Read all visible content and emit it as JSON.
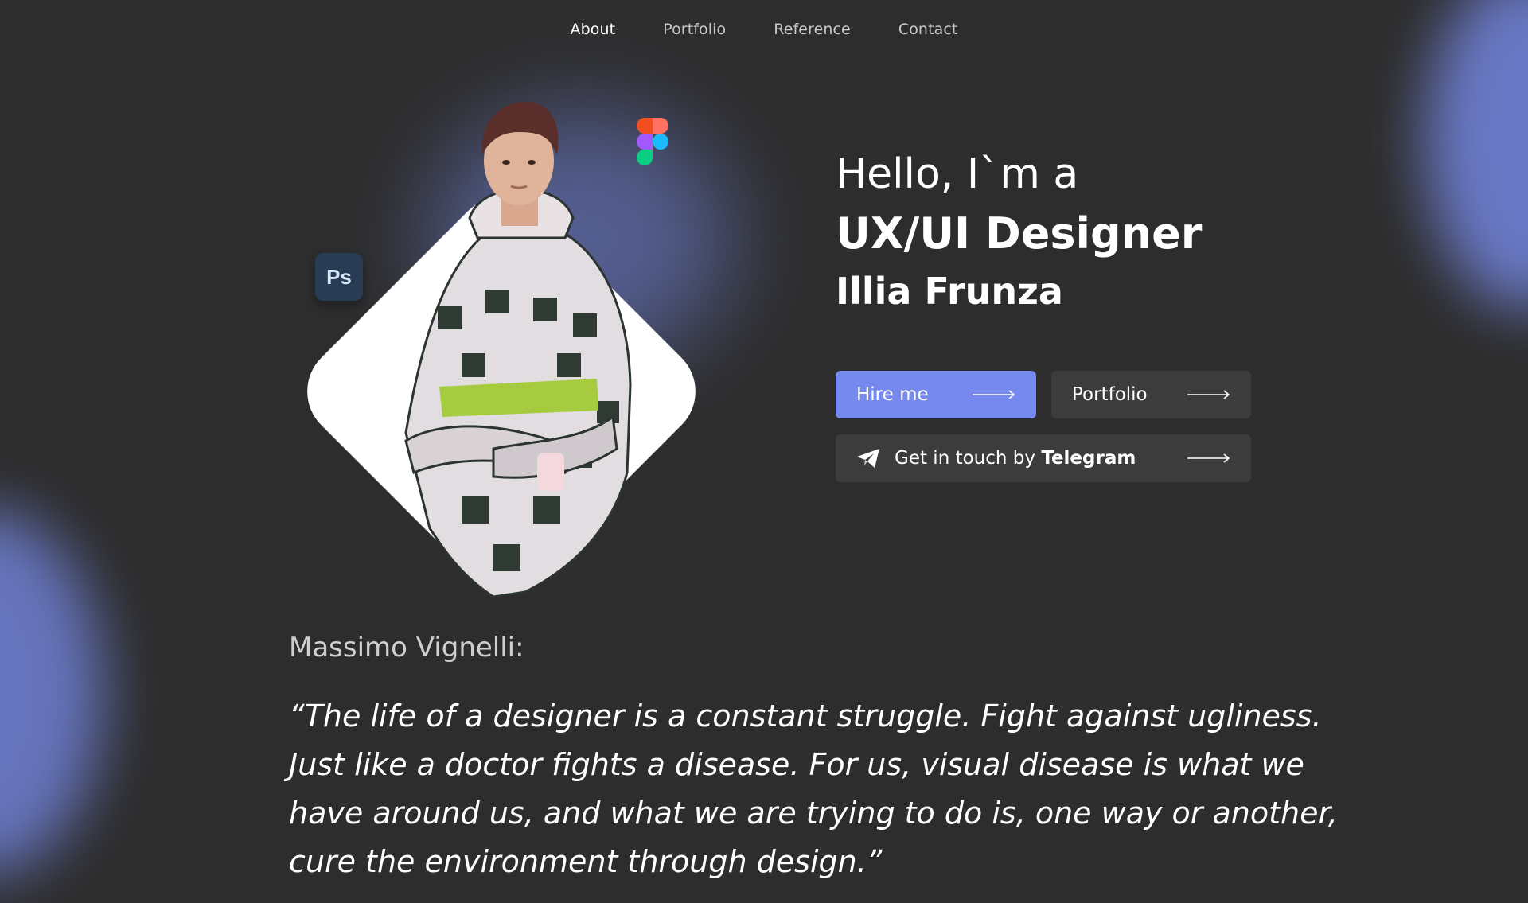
{
  "nav": {
    "items": [
      {
        "label": "About",
        "active": true
      },
      {
        "label": "Portfolio",
        "active": false
      },
      {
        "label": "Reference",
        "active": false
      },
      {
        "label": "Contact",
        "active": false
      }
    ]
  },
  "hero": {
    "greeting": "Hello, I`m a",
    "role": "UX/UI Designer",
    "name": "Illia Frunza",
    "ps_badge": "Ps",
    "icons": [
      "photoshop-icon",
      "figma-icon"
    ]
  },
  "buttons": {
    "hire_label": "Hire me",
    "portfolio_label": "Portfolio",
    "telegram_prefix": "Get in touch by",
    "telegram_strong": "Telegram"
  },
  "quote": {
    "author": "Massimo Vignelli:",
    "text": "“The life of a designer is a constant struggle. Fight against ugliness. Just like a doctor fights a disease. For us, visual disease is what we have around us, and what we are trying to do is, one way or another, cure the environment through design.”"
  },
  "colors": {
    "background": "#2d2d2d",
    "accent": "#7689ef",
    "button_secondary": "#3c3c3c",
    "glow": "#7486e0"
  }
}
